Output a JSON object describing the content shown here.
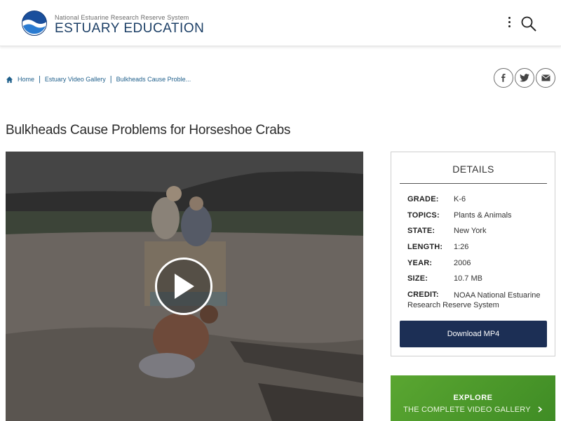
{
  "header": {
    "org_name": "National Estuarine Research Reserve System",
    "site_title": "ESTUARY EDUCATION"
  },
  "breadcrumb": {
    "items": [
      "Home",
      "Estuary Video Gallery",
      "Bulkheads Cause Proble..."
    ]
  },
  "page_title": "Bulkheads Cause Problems for Horseshoe Crabs",
  "details": {
    "heading": "DETAILS",
    "rows": [
      {
        "key": "GRADE:",
        "value": "K-6"
      },
      {
        "key": "TOPICS:",
        "value": "Plants & Animals"
      },
      {
        "key": "STATE:",
        "value": "New York"
      },
      {
        "key": "LENGTH:",
        "value": "1:26"
      },
      {
        "key": "YEAR:",
        "value": "2006"
      },
      {
        "key": "SIZE:",
        "value": "10.7 MB"
      },
      {
        "key": "CREDIT:",
        "value": "NOAA National Estuarine",
        "value2": "Research Reserve System"
      }
    ],
    "download_label": "Download MP4"
  },
  "explore": {
    "line1": "EXPLORE",
    "line2": "THE COMPLETE VIDEO GALLERY"
  },
  "icons": {
    "logo": "noaa-logo",
    "menu": "kebab-menu-icon",
    "search": "search-icon",
    "home": "home-icon",
    "facebook": "facebook-icon",
    "twitter": "twitter-icon",
    "email": "email-icon",
    "play": "play-icon",
    "chevron": "chevron-right-icon"
  },
  "colors": {
    "brand_navy": "#1c3f66",
    "download_bg": "#1c2f55",
    "explore_green": "#4d9a2b",
    "link_blue": "#1f5f8b"
  }
}
